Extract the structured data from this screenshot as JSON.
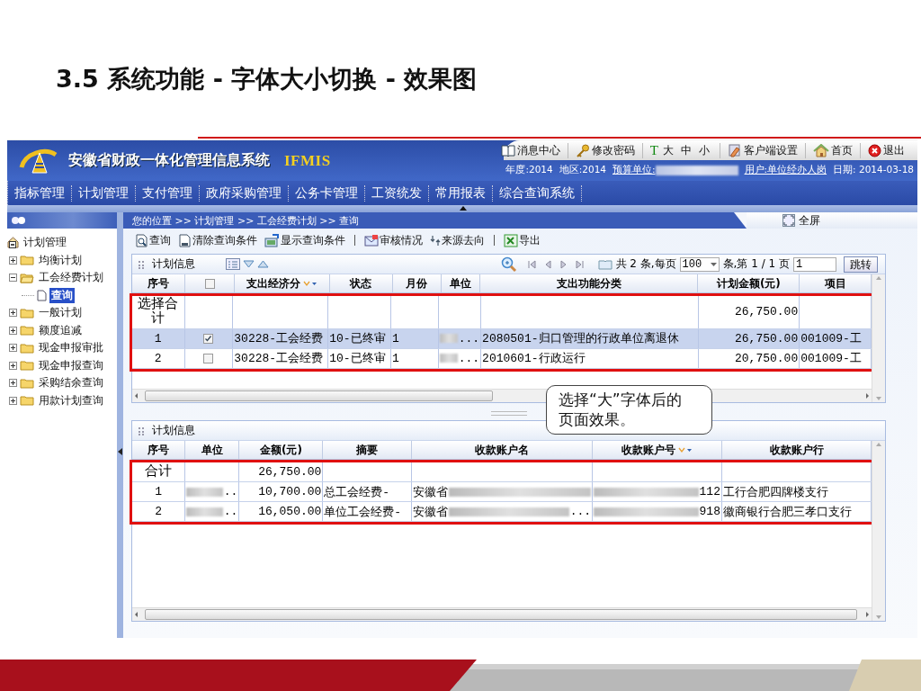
{
  "slide": {
    "title": "3.5  系统功能 - 字体大小切换 - 效果图"
  },
  "header": {
    "system_name": "安徽省财政一体化管理信息系统",
    "brand": "IFMIS",
    "tools": [
      {
        "kind": "messages",
        "label": "消息中心"
      },
      {
        "kind": "password",
        "label": "修改密码"
      },
      {
        "kind": "font_size",
        "glyph": "T",
        "options": [
          "大",
          "中",
          "小"
        ]
      },
      {
        "kind": "client",
        "label": "客户端设置"
      },
      {
        "kind": "home",
        "label": "首页"
      },
      {
        "kind": "exit",
        "label": "退出"
      }
    ],
    "info": [
      {
        "text": "年度:2014"
      },
      {
        "text": "地区:2014"
      },
      {
        "text": "预算单位:",
        "link": true,
        "blur": true
      },
      {
        "text": "用户:单位经办人岗",
        "link": true
      },
      {
        "text": "日期: 2014-03-18"
      }
    ],
    "nav": [
      "指标管理",
      "计划管理",
      "支付管理",
      "政府采购管理",
      "公务卡管理",
      "工资统发",
      "常用报表",
      "综合查询系统"
    ]
  },
  "breadcrumb": "您的位置 >> 计划管理 >> 工会经费计划 >> 查询",
  "fullscreen": "全屏",
  "tree": {
    "label": "计划管理",
    "expanded": true,
    "selected": false,
    "children": [
      {
        "label": "均衡计划",
        "expanded": false,
        "selected": false
      },
      {
        "label": "工会经费计划",
        "expanded": true,
        "selected": false,
        "children": [
          {
            "label": "查询",
            "selected": true
          }
        ]
      },
      {
        "label": "一般计划",
        "expanded": false,
        "selected": false
      },
      {
        "label": "额度追减",
        "expanded": false,
        "selected": false
      },
      {
        "label": "现金申报审批",
        "expanded": false,
        "selected": false
      },
      {
        "label": "现金申报查询",
        "expanded": false,
        "selected": false
      },
      {
        "label": "采购结余查询",
        "expanded": false,
        "selected": false
      },
      {
        "label": "用款计划查询",
        "expanded": false,
        "selected": false
      }
    ]
  },
  "actions": [
    {
      "kind": "search",
      "label": "查询"
    },
    {
      "kind": "clear",
      "label": "清除查询条件"
    },
    {
      "kind": "show",
      "label": "显示查询条件"
    },
    {
      "kind": "audit",
      "label": "审核情况",
      "separator_before": true
    },
    {
      "kind": "flow",
      "label": "来源去向"
    },
    {
      "kind": "excel",
      "label": "导出",
      "separator_before": true
    }
  ],
  "upper_grid": {
    "title": "计划信息",
    "view_controls": true,
    "highlighted": true,
    "pager": {
      "total": "共 2 条,每页",
      "page_size": "100",
      "page_info": "条,第 1 / 1 页",
      "page_input": "1",
      "jump": "跳转"
    },
    "columns": [
      {
        "kind": "index",
        "label": "序号"
      },
      {
        "kind": "checkbox",
        "checked": false
      },
      {
        "kind": "text",
        "label": "支出经济分",
        "sortable": true
      },
      {
        "kind": "text",
        "label": "状态"
      },
      {
        "kind": "text",
        "label": "月份"
      },
      {
        "kind": "text",
        "label": "单位"
      },
      {
        "kind": "text",
        "label": "支出功能分类"
      },
      {
        "kind": "amount",
        "label": "计划金额(元)"
      },
      {
        "kind": "text",
        "label": "项目"
      }
    ],
    "rows": [
      {
        "kind": "total",
        "selected": false,
        "cells": [
          "选择合计",
          null,
          null,
          null,
          null,
          null,
          null,
          "26,750.00",
          null
        ]
      },
      {
        "kind": "data",
        "selected": true,
        "checked": true,
        "cells": [
          "1",
          null,
          "30228-工会经费",
          "10-已终审",
          "1",
          {
            "blur": true,
            "after": "..."
          },
          "2080501-归口管理的行政单位离退休",
          "26,750.00",
          "001009-工"
        ]
      },
      {
        "kind": "data",
        "selected": false,
        "checked": false,
        "cells": [
          "2",
          null,
          "30228-工会经费",
          "10-已终审",
          "1",
          {
            "blur": true,
            "after": "..."
          },
          "2010601-行政运行",
          "20,750.00",
          "001009-工"
        ]
      }
    ]
  },
  "lower_grid": {
    "title": "计划信息",
    "view_controls": false,
    "highlighted": true,
    "columns": [
      {
        "kind": "index",
        "label": "序号"
      },
      {
        "kind": "text",
        "label": "单位"
      },
      {
        "kind": "amount",
        "label": "金额(元)"
      },
      {
        "kind": "text",
        "label": "摘要"
      },
      {
        "kind": "text",
        "label": "收款账户名"
      },
      {
        "kind": "text",
        "label": "收款账户号",
        "sortable": true
      },
      {
        "kind": "text",
        "label": "收款账户行"
      }
    ],
    "rows": [
      {
        "kind": "total",
        "selected": false,
        "cells": [
          "合计",
          null,
          "26,750.00",
          null,
          null,
          null,
          null
        ]
      },
      {
        "kind": "data",
        "selected": false,
        "cells": [
          "1",
          {
            "blur": true,
            "after": ".."
          },
          "10,700.00",
          "总工会经费-",
          {
            "before": "安徽省",
            "blur": true
          },
          {
            "blur": true,
            "after": "112"
          },
          "工行合肥四牌楼支行"
        ]
      },
      {
        "kind": "data",
        "selected": false,
        "cells": [
          "2",
          {
            "blur": true,
            "after": ".."
          },
          "16,050.00",
          "单位工会经费-",
          {
            "before": "安徽省",
            "blur": true,
            "after": "..."
          },
          {
            "blur": true,
            "after": "918"
          },
          "徽商银行合肥三孝口支行"
        ]
      }
    ]
  },
  "callout": "选择“大”字体后的页面效果。"
}
